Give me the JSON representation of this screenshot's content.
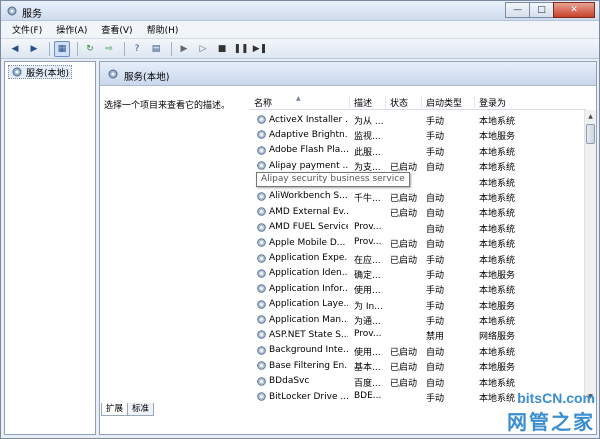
{
  "window": {
    "title": "服务"
  },
  "window_controls": {
    "minimize": "—",
    "maximize": "□",
    "close": "✕"
  },
  "menu": {
    "items": [
      "文件(F)",
      "操作(A)",
      "查看(V)",
      "帮助(H)"
    ]
  },
  "toolbar": {
    "icons": [
      "back-icon",
      "forward-icon",
      "console-tree-icon",
      "refresh-icon",
      "export-icon",
      "help-icon",
      "properties-icon",
      "play-icon",
      "play-icon",
      "stop-icon",
      "pause-icon",
      "restart-icon"
    ]
  },
  "tree": {
    "root_label": "服务(本地)"
  },
  "panel": {
    "header": "服务(本地)",
    "description_prompt": "选择一个项目来查看它的描述。"
  },
  "columns": {
    "name": "名称",
    "description": "描述",
    "status": "状态",
    "startup": "启动类型",
    "logon": "登录为"
  },
  "services": [
    {
      "name": "ActiveX Installer ...",
      "desc": "为从 ...",
      "status": "",
      "startup": "手动",
      "logon": "本地系统"
    },
    {
      "name": "Adaptive Brightn...",
      "desc": "监视...",
      "status": "",
      "startup": "手动",
      "logon": "本地服务"
    },
    {
      "name": "Adobe Flash Pla...",
      "desc": "此服...",
      "status": "",
      "startup": "手动",
      "logon": "本地系统"
    },
    {
      "name": "Alipay payment ...",
      "desc": "为支...",
      "status": "已启动",
      "startup": "自动",
      "logon": "本地系统"
    },
    {
      "name": "Alipay security ...",
      "desc": "",
      "status": "",
      "startup": "",
      "logon": "本地系统"
    },
    {
      "name": "AliWorkbench S...",
      "desc": "千牛...",
      "status": "已启动",
      "startup": "自动",
      "logon": "本地系统"
    },
    {
      "name": "AMD External Ev...",
      "desc": "",
      "status": "已启动",
      "startup": "自动",
      "logon": "本地系统"
    },
    {
      "name": "AMD FUEL Service",
      "desc": "Prov...",
      "status": "",
      "startup": "自动",
      "logon": "本地系统"
    },
    {
      "name": "Apple Mobile D...",
      "desc": "Prov...",
      "status": "已启动",
      "startup": "自动",
      "logon": "本地系统"
    },
    {
      "name": "Application Expe...",
      "desc": "在应...",
      "status": "已启动",
      "startup": "手动",
      "logon": "本地系统"
    },
    {
      "name": "Application Iden...",
      "desc": "确定...",
      "status": "",
      "startup": "手动",
      "logon": "本地服务"
    },
    {
      "name": "Application Infor...",
      "desc": "使用...",
      "status": "",
      "startup": "手动",
      "logon": "本地系统"
    },
    {
      "name": "Application Laye...",
      "desc": "为 In...",
      "status": "",
      "startup": "手动",
      "logon": "本地服务"
    },
    {
      "name": "Application Man...",
      "desc": "为通...",
      "status": "",
      "startup": "手动",
      "logon": "本地系统"
    },
    {
      "name": "ASP.NET State S...",
      "desc": "Prov...",
      "status": "",
      "startup": "禁用",
      "logon": "网络服务"
    },
    {
      "name": "Background Inte...",
      "desc": "使用...",
      "status": "已启动",
      "startup": "自动",
      "logon": "本地系统"
    },
    {
      "name": "Base Filtering En...",
      "desc": "基本...",
      "status": "已启动",
      "startup": "自动",
      "logon": "本地服务"
    },
    {
      "name": "BDdaSvc",
      "desc": "百度...",
      "status": "已启动",
      "startup": "自动",
      "logon": "本地系统"
    },
    {
      "name": "BitLocker Drive ...",
      "desc": "BDE...",
      "status": "",
      "startup": "手动",
      "logon": "本地系统"
    }
  ],
  "tooltip": {
    "text": "Alipay security business service"
  },
  "bottom_tabs": [
    "扩展",
    "标准"
  ],
  "watermark": {
    "line1": "bitsCN.com",
    "line2": "网管之家"
  },
  "colors": {
    "accent": "#3b8fd1",
    "header_bg": "#c9d8ec",
    "tree_selected": "#e4edf9"
  }
}
